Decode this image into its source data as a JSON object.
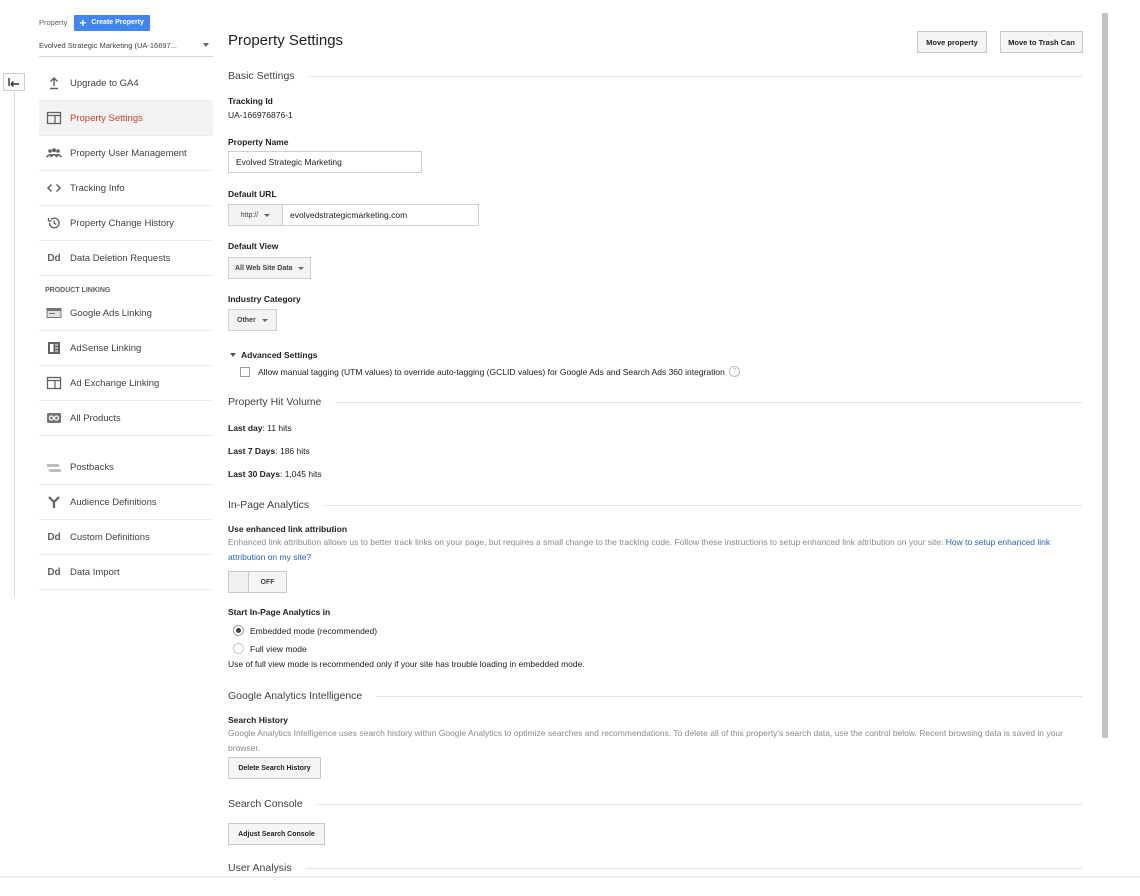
{
  "sidebar": {
    "property_label": "Property",
    "create_property_label": "Create Property",
    "account_selector_value": "Evolved Strategic Marketing (UA-16697...",
    "items": [
      {
        "label": "Upgrade to GA4",
        "icon": "upload-icon"
      },
      {
        "label": "Property Settings",
        "icon": "window-icon"
      },
      {
        "label": "Property User Management",
        "icon": "users-icon"
      },
      {
        "label": "Tracking Info",
        "icon": "code-icon"
      },
      {
        "label": "Property Change History",
        "icon": "history-icon"
      },
      {
        "label": "Data Deletion Requests",
        "icon": "dd-icon"
      }
    ],
    "product_linking_heading": "PRODUCT LINKING",
    "linking_items": [
      {
        "label": "Google Ads Linking",
        "icon": "google-ads-icon"
      },
      {
        "label": "AdSense Linking",
        "icon": "adsense-icon"
      },
      {
        "label": "Ad Exchange Linking",
        "icon": "ad-exchange-icon"
      },
      {
        "label": "All Products",
        "icon": "all-products-icon"
      }
    ],
    "other_items": [
      {
        "label": "Postbacks",
        "icon": "postbacks-icon"
      },
      {
        "label": "Audience Definitions",
        "icon": "audience-icon"
      },
      {
        "label": "Custom Definitions",
        "icon": "dd-icon"
      },
      {
        "label": "Data Import",
        "icon": "dd-icon"
      }
    ]
  },
  "header": {
    "title": "Property Settings",
    "move_property_label": "Move property",
    "move_to_trash_label": "Move to Trash Can"
  },
  "basic_settings": {
    "section_title": "Basic Settings",
    "tracking_id_label": "Tracking Id",
    "tracking_id_value": "UA-166976876-1",
    "property_name_label": "Property Name",
    "property_name_value": "Evolved Strategic Marketing",
    "default_url_label": "Default URL",
    "default_url_protocol": "http://",
    "default_url_host": "evolvedstrategicmarketing.com",
    "default_view_label": "Default View",
    "default_view_value": "All Web Site Data",
    "industry_category_label": "Industry Category",
    "industry_category_value": "Other",
    "advanced_settings_label": "Advanced Settings",
    "manual_tagging_label": "Allow manual tagging (UTM values) to override auto-tagging (GCLID values) for Google Ads and Search Ads 360 integration",
    "help_glyph": "?"
  },
  "hit_volume": {
    "section_title": "Property Hit Volume",
    "last_day_label": "Last day",
    "last_day_value": ": 11 hits",
    "last_7_label": "Last 7 Days",
    "last_7_value": ": 186 hits",
    "last_30_label": "Last 30 Days",
    "last_30_value": ": 1,045 hits"
  },
  "in_page_analytics": {
    "section_title": "In-Page Analytics",
    "enhanced_link_label": "Use enhanced link attribution",
    "enhanced_link_desc": "Enhanced link attribution allows us to better track links on your page, but requires a small change to the tracking code. Follow these instructions to setup enhanced link attribution on your site: ",
    "enhanced_link_help": "How to setup enhanced link attribution on my site?",
    "toggle_state": "OFF",
    "start_label": "Start In-Page Analytics in",
    "embedded_mode": "Embedded mode (recommended)",
    "full_view_mode": "Full view mode",
    "full_view_note": "Use of full view mode is recommended only if your site has trouble loading in embedded mode."
  },
  "intelligence": {
    "section_title": "Google Analytics Intelligence",
    "search_history_label": "Search History",
    "search_history_desc": "Google Analytics Intelligence uses search history within Google Analytics to optimize searches and recommendations. To delete all of this property's search data, use the control below. Recent browsing data is saved in your browser.",
    "delete_button": "Delete Search History"
  },
  "search_console": {
    "section_title": "Search Console",
    "adjust_button": "Adjust Search Console"
  },
  "user_analysis": {
    "section_title": "User Analysis"
  },
  "colors": {
    "accent_blue": "#4285f4",
    "active_nav": "#c5432b",
    "link": "#2962c4"
  }
}
